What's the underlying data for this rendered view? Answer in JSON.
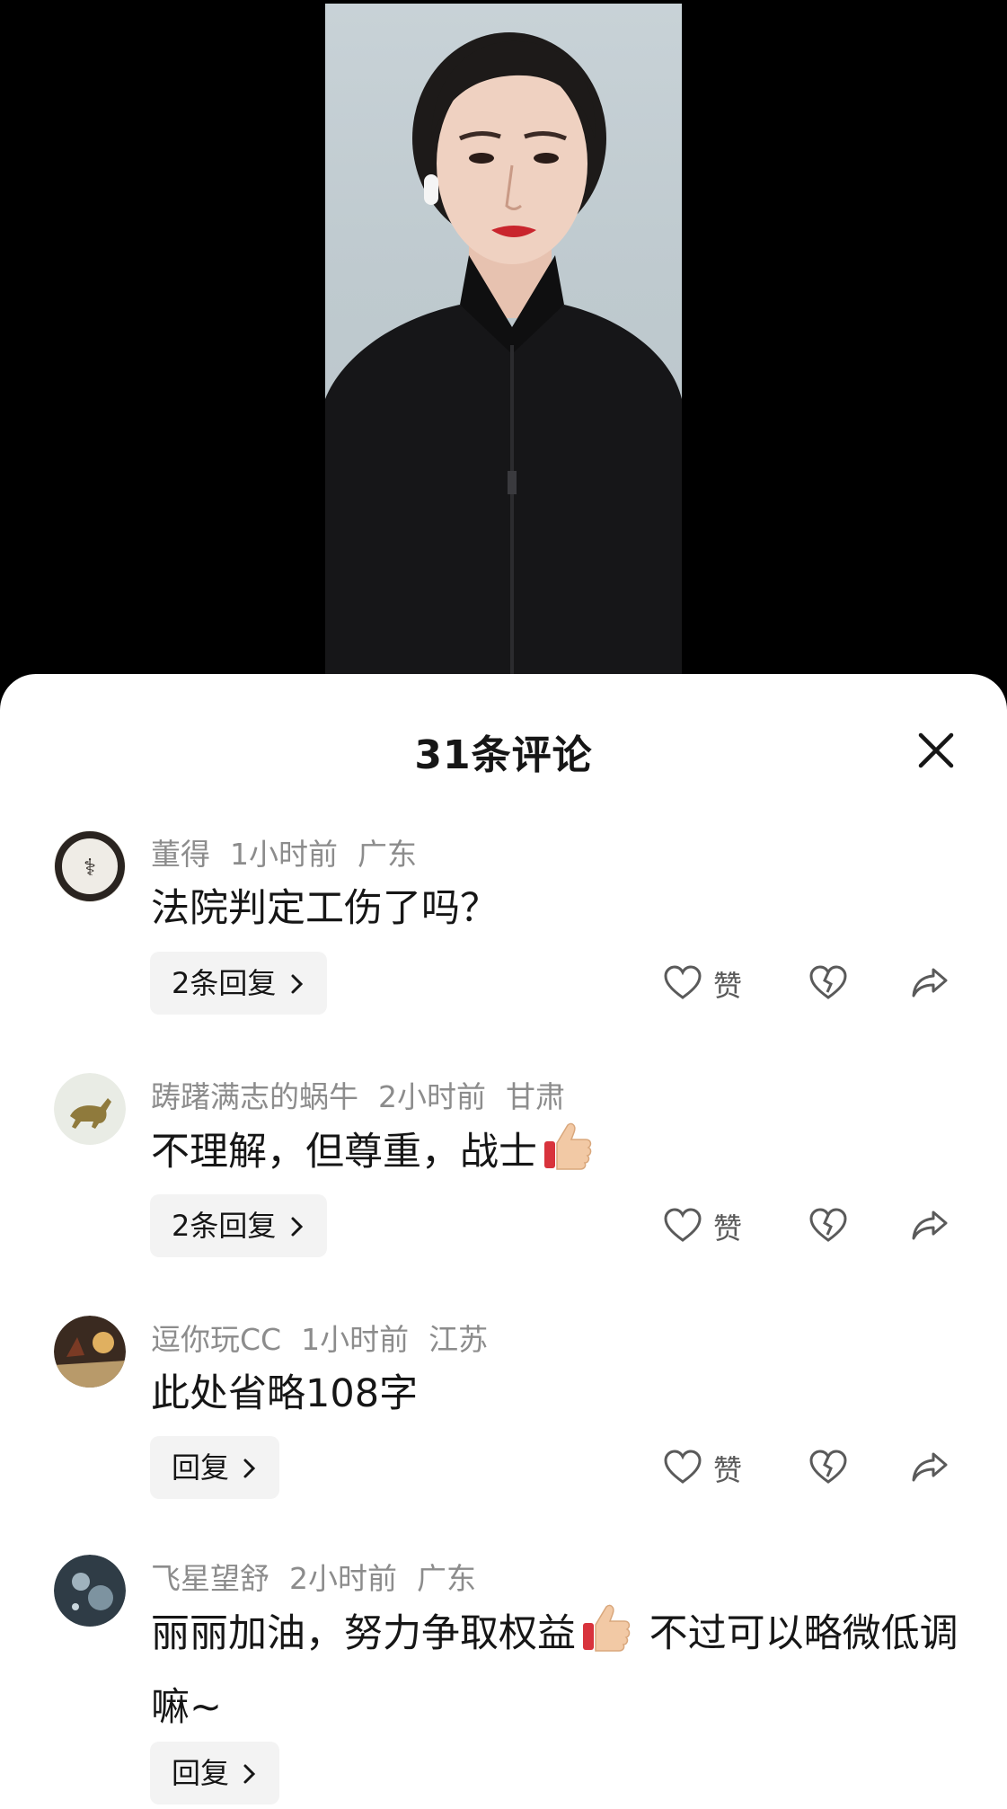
{
  "sheet": {
    "title": "31条评论",
    "close_icon": "close-icon"
  },
  "comments": [
    {
      "user": "董得",
      "time": "1小时前",
      "region": "广东",
      "text": "法院判定工伤了吗？",
      "reply_label": "2条回复",
      "like_label": "赞"
    },
    {
      "user": "踌躇满志的蜗牛",
      "time": "2小时前",
      "region": "甘肃",
      "text": "不理解，但尊重，战士",
      "reply_label": "2条回复",
      "like_label": "赞"
    },
    {
      "user": "逗你玩CC",
      "time": "1小时前",
      "region": "江苏",
      "text": "此处省略108字",
      "reply_label": "回复",
      "like_label": "赞"
    },
    {
      "user": "飞星望舒",
      "time": "2小时前",
      "region": "广东",
      "text_before": "丽丽加油，努力争取权益",
      "text_after": " 不过可以略微低调嘛~",
      "reply_label": "回复"
    }
  ],
  "colors": {
    "sheet_bg": "#ffffff",
    "meta_text": "#8c8c8c",
    "body_text": "#161616",
    "reply_bg": "#f3f3f3"
  }
}
